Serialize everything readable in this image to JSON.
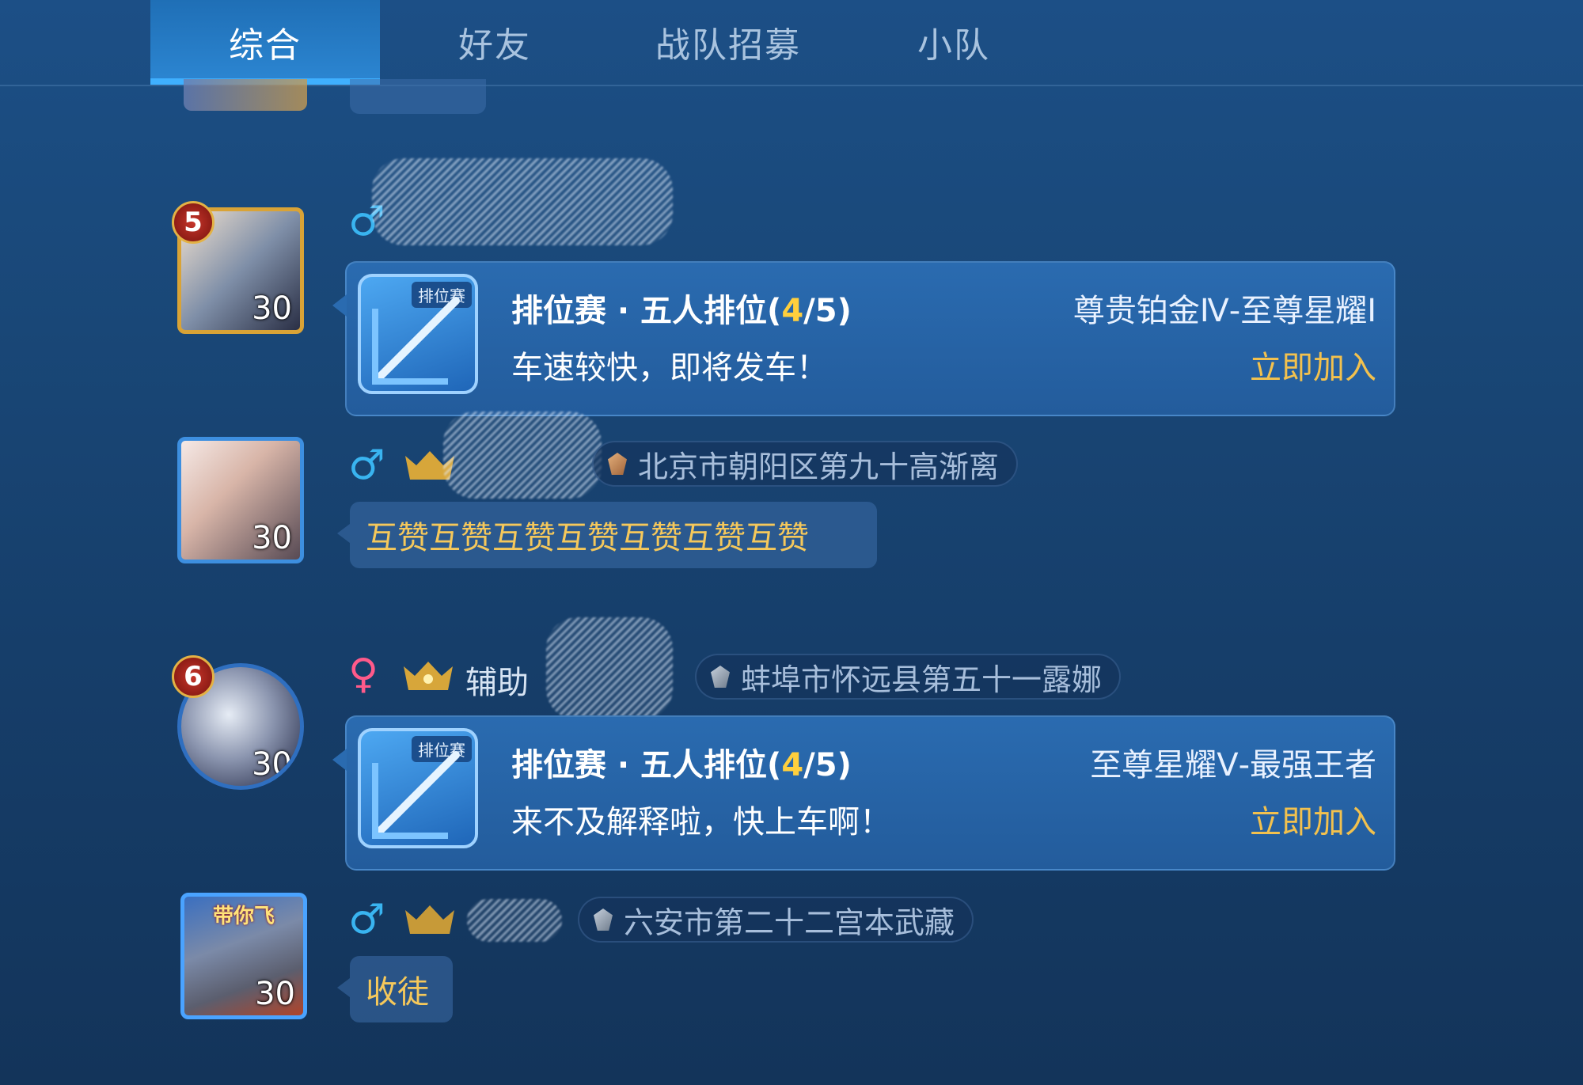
{
  "tabs": [
    "综合",
    "好友",
    "战队招募",
    "小队"
  ],
  "active_tab": 0,
  "entries": [
    {
      "avatar_level": "30",
      "rank_badge": "5",
      "gender": "♂",
      "card": {
        "tag": "排位赛",
        "title_prefix": "排位赛 · 五人排位(",
        "title_count": "4",
        "title_suffix": "/5)",
        "rank_range": "尊贵铂金Ⅳ-至尊星耀Ⅰ",
        "desc": "车速较快，即将发车！",
        "join": "立即加入"
      }
    },
    {
      "avatar_level": "30",
      "gender": "♂",
      "location": "北京市朝阳区第九十高渐离",
      "message": "互赞互赞互赞互赞互赞互赞互赞"
    },
    {
      "avatar_level": "30",
      "rank_badge": "6",
      "gender": "♀",
      "name": "辅助",
      "location": "蚌埠市怀远县第五十一露娜",
      "card": {
        "tag": "排位赛",
        "title_prefix": "排位赛 · 五人排位(",
        "title_count": "4",
        "title_suffix": "/5)",
        "rank_range": "至尊星耀Ⅴ-最强王者",
        "desc": "来不及解释啦，快上车啊！",
        "join": "立即加入"
      }
    },
    {
      "avatar_level": "30",
      "avatar_tag": "带你飞",
      "gender": "♂",
      "location": "六安市第二十二宫本武藏",
      "message": "收徒"
    }
  ]
}
